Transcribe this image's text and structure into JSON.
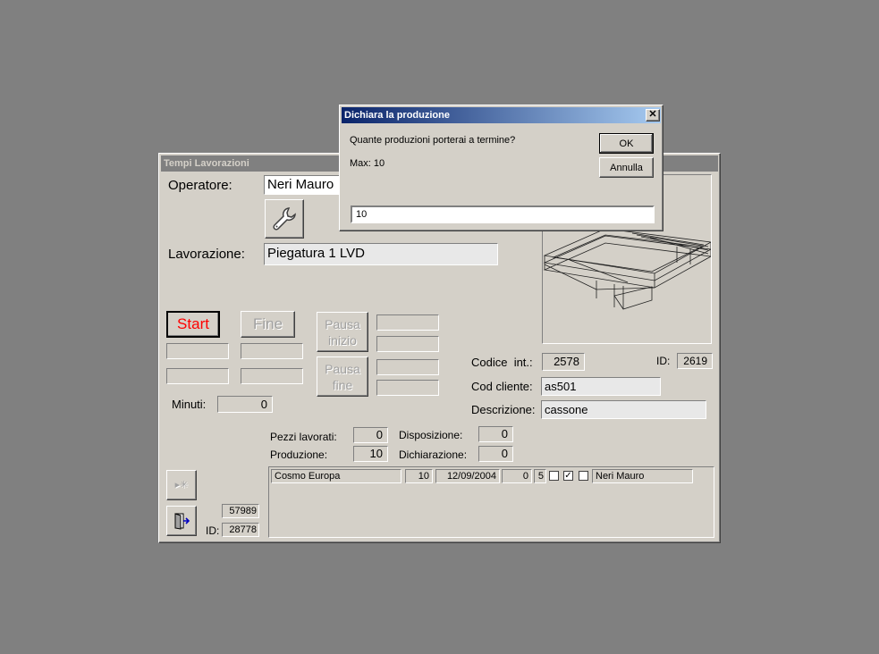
{
  "main_window": {
    "title": "Tempi Lavorazioni",
    "operatore_label": "Operatore:",
    "operatore_value": "Neri Mauro",
    "lavorazione_label": "Lavorazione:",
    "lavorazione_value": "Piegatura 1 LVD",
    "start_label": "Start",
    "fine_label": "Fine",
    "pausa_inizio_label": "Pausa\ninizio",
    "pausa_fine_label": "Pausa\nfine",
    "minuti_label": "Minuti:",
    "minuti_value": "0",
    "codice_int_label": "Codice  int.:",
    "codice_int_value": "2578",
    "id_label": "ID:",
    "id_value": "2619",
    "cod_cliente_label": "Cod cliente:",
    "cod_cliente_value": "as501",
    "descrizione_label": "Descrizione:",
    "descrizione_value": "cassone",
    "pezzi_lavorati_label": "Pezzi lavorati:",
    "pezzi_lavorati_value": "0",
    "produzione_label": "Produzione:",
    "produzione_value": "10",
    "disposizione_label": "Disposizione:",
    "disposizione_value": "0",
    "dichiarazione_label": "Dichiarazione:",
    "dichiarazione_value": "0",
    "record_value": "57989",
    "bottom_id_label": "ID:",
    "bottom_id_value": "28778",
    "grid_row": {
      "cliente": "Cosmo Europa",
      "qta": "10",
      "data": "12/09/2004",
      "c1": "0",
      "c2": "5",
      "chk1": false,
      "chk2": true,
      "chk3": false,
      "operatore": "Neri Mauro"
    }
  },
  "dialog": {
    "title": "Dichiara la produzione",
    "prompt": "Quante produzioni porterai a termine?",
    "max_text": "Max: 10",
    "ok_label": "OK",
    "annulla_label": "Annulla",
    "input_value": "10"
  }
}
